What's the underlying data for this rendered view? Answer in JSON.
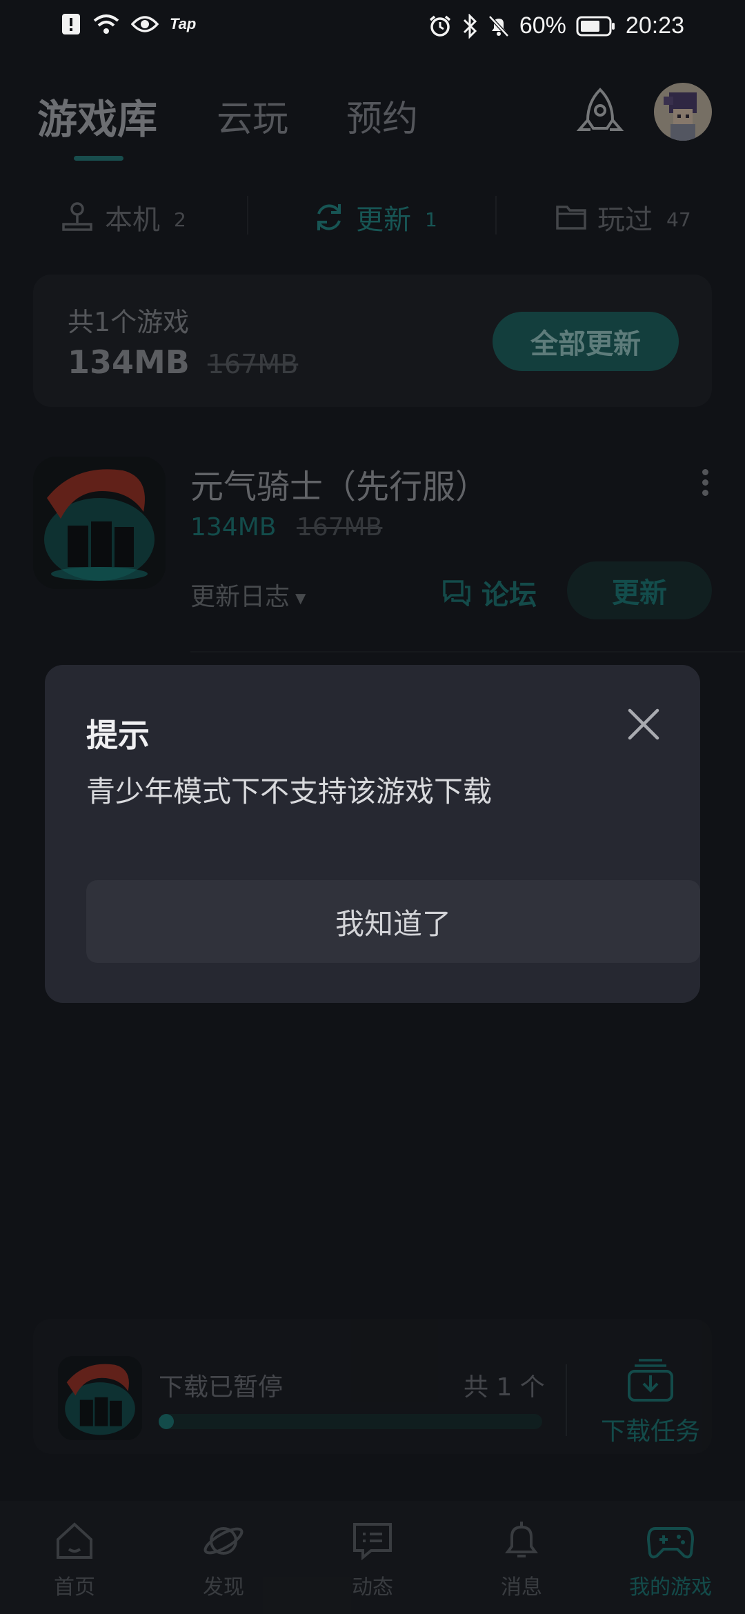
{
  "status_bar": {
    "left_app_label": "Tap",
    "battery": "60%",
    "time": "20:23"
  },
  "top_tabs": [
    {
      "label": "游戏库",
      "active": true
    },
    {
      "label": "云玩",
      "active": false
    },
    {
      "label": "预约",
      "active": false
    }
  ],
  "filters": [
    {
      "label": "本机",
      "count": "2",
      "icon": "joystick-icon"
    },
    {
      "label": "更新",
      "count": "1",
      "icon": "refresh-icon",
      "active": true
    },
    {
      "label": "玩过",
      "count": "47",
      "icon": "folder-icon"
    }
  ],
  "summary": {
    "title": "共1个游戏",
    "size": "134MB",
    "old_size": "167MB",
    "update_all_label": "全部更新"
  },
  "game": {
    "title": "元气骑士（先行服）",
    "size": "134MB",
    "old_size": "167MB",
    "changelog_label": "更新日志",
    "forum_label": "论坛",
    "update_label": "更新"
  },
  "dialog": {
    "title": "提示",
    "message": "青少年模式下不支持该游戏下载",
    "ok_label": "我知道了"
  },
  "download_bar": {
    "status": "下载已暂停",
    "count": "共 1 个",
    "progress": 0.02,
    "task_label": "下载任务"
  },
  "bottom_nav": [
    {
      "label": "首页",
      "icon": "home-icon"
    },
    {
      "label": "发现",
      "icon": "planet-icon"
    },
    {
      "label": "动态",
      "icon": "message-icon"
    },
    {
      "label": "消息",
      "icon": "bell-icon"
    },
    {
      "label": "我的游戏",
      "icon": "gamepad-icon",
      "active": true
    }
  ],
  "colors": {
    "accent": "#1e8d89",
    "background": "#101216",
    "dialog": "#262831"
  }
}
